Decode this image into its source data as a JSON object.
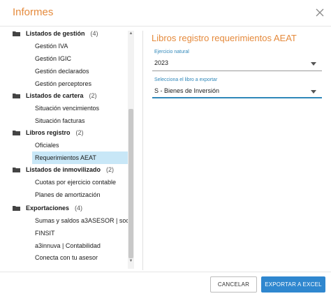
{
  "dialog": {
    "title": "Informes",
    "close_icon": "close-icon"
  },
  "tree": {
    "groups": [
      {
        "label": "Listados de gestión",
        "count": "(4)"
      },
      {
        "label": "Listados de cartera",
        "count": "(2)"
      },
      {
        "label": "Libros registro",
        "count": "(2)"
      },
      {
        "label": "Listados de inmovilizado",
        "count": "(2)"
      },
      {
        "label": "Exportaciones",
        "count": "(4)"
      }
    ],
    "children": [
      "Gestión IVA",
      "Gestión IGIC",
      "Gestión declarados",
      "Gestión perceptores",
      "Situación vencimientos",
      "Situación facturas",
      "Oficiales",
      "Requerimientos AEAT",
      "Cuotas por ejercicio contable",
      "Planes de amortización",
      "Sumas y saldos a3ASESOR | soc",
      "FINSIT",
      "a3innuva | Contabilidad",
      "Conecta con tu asesor"
    ],
    "selected": "Requerimientos AEAT"
  },
  "panel": {
    "title": "Libros registro requerimientos AEAT",
    "ejercicio": {
      "label": "Ejercicio natural",
      "value": "2023"
    },
    "libro": {
      "label": "Selecciona el libro a exportar",
      "value": "S - Bienes de Inversión"
    }
  },
  "footer": {
    "cancel_label": "CANCELAR",
    "export_label": "EXPORTAR A EXCEL"
  },
  "colors": {
    "accent": "#e58a3c",
    "primary": "#2f87cf",
    "selected_bg": "#c8e7f7"
  }
}
